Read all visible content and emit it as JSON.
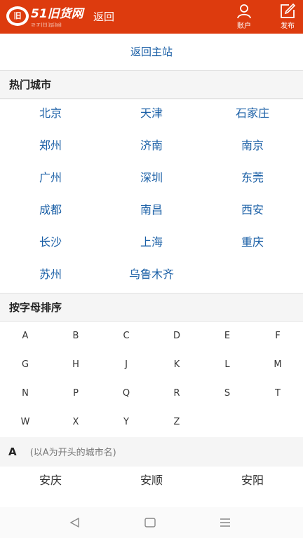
{
  "header": {
    "logo_text": "51旧货网",
    "logo_badge": "旧",
    "back_label": "返回",
    "account_label": "账户",
    "publish_label": "发布"
  },
  "home_link": "返回主站",
  "hot_section": {
    "title": "热门城市",
    "cities": [
      "北京",
      "天津",
      "石家庄",
      "郑州",
      "济南",
      "南京",
      "广州",
      "深圳",
      "东莞",
      "成都",
      "南昌",
      "西安",
      "长沙",
      "上海",
      "重庆",
      "苏州",
      "乌鲁木齐"
    ]
  },
  "alpha_section": {
    "title": "按字母排序",
    "letters": [
      "A",
      "B",
      "C",
      "D",
      "E",
      "F",
      "G",
      "H",
      "J",
      "K",
      "L",
      "M",
      "N",
      "P",
      "Q",
      "R",
      "S",
      "T",
      "W",
      "X",
      "Y",
      "Z"
    ]
  },
  "group_a": {
    "letter": "A",
    "hint": "(以A为开头的城市名)",
    "cities": [
      "安庆",
      "安顺",
      "安阳"
    ]
  },
  "colors": {
    "brand": "#dd3b0e",
    "link": "#1a5fa6"
  },
  "icons": [
    "back-icon",
    "home-icon",
    "menu-icon",
    "account-icon",
    "publish-icon"
  ]
}
